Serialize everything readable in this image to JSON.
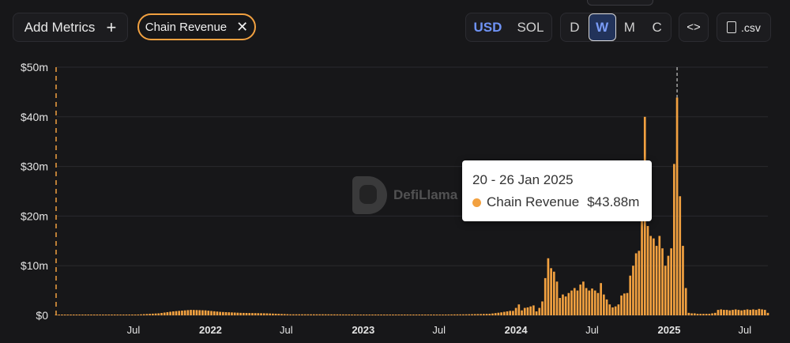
{
  "toolbar": {
    "add_metrics_label": "Add Metrics",
    "add_metrics_icon": "plus-icon",
    "chip_label": "Chain Revenue",
    "chip_close_icon": "close-icon",
    "currency_options": [
      "USD",
      "SOL"
    ],
    "currency_selected": "USD",
    "granularity_options": [
      "D",
      "W",
      "M",
      "C"
    ],
    "granularity_selected": "W",
    "embed_icon": "code-icon",
    "csv_label": ".csv",
    "csv_icon": "file-download-icon"
  },
  "watermark": {
    "text": "DefiLlama"
  },
  "tooltip": {
    "date": "20 - 26 Jan 2025",
    "series": "Chain Revenue",
    "value": "$43.88m"
  },
  "colors": {
    "background": "#171719",
    "series": "#f2a140",
    "accent": "#6f93f5",
    "grid": "#2a2a2e"
  },
  "chart_data": {
    "type": "bar",
    "title": "",
    "xlabel": "",
    "ylabel": "",
    "ylim": [
      0,
      50
    ],
    "y_unit": "$m",
    "yticks": [
      "$0",
      "$10m",
      "$20m",
      "$30m",
      "$40m",
      "$50m"
    ],
    "yticks_values": [
      0,
      10,
      20,
      30,
      40,
      50
    ],
    "xticks": [
      {
        "label": "Jul",
        "date": "2021-07-01",
        "bold": false
      },
      {
        "label": "2022",
        "date": "2022-01-01",
        "bold": true
      },
      {
        "label": "Jul",
        "date": "2022-07-01",
        "bold": false
      },
      {
        "label": "2023",
        "date": "2023-01-01",
        "bold": true
      },
      {
        "label": "Jul",
        "date": "2023-07-01",
        "bold": false
      },
      {
        "label": "2024",
        "date": "2024-01-01",
        "bold": true
      },
      {
        "label": "Jul",
        "date": "2024-07-01",
        "bold": false
      },
      {
        "label": "2025",
        "date": "2025-01-01",
        "bold": true
      },
      {
        "label": "Jul",
        "date": "2025-07-01",
        "bold": false
      }
    ],
    "x_start": "2020-12-28",
    "x_end": "2025-08-25",
    "highlight_date": "2025-01-20",
    "grid": true,
    "series": [
      {
        "name": "Chain Revenue",
        "anchors": [
          [
            "2020-12-28",
            0.05
          ],
          [
            "2021-06-28",
            0.1
          ],
          [
            "2021-08-30",
            0.4
          ],
          [
            "2021-10-04",
            0.8
          ],
          [
            "2021-11-15",
            1.1
          ],
          [
            "2021-12-20",
            1.0
          ],
          [
            "2022-01-24",
            0.7
          ],
          [
            "2022-03-14",
            0.5
          ],
          [
            "2022-05-16",
            0.4
          ],
          [
            "2022-07-11",
            0.2
          ],
          [
            "2022-09-26",
            0.2
          ],
          [
            "2023-01-02",
            0.15
          ],
          [
            "2023-04-03",
            0.15
          ],
          [
            "2023-07-03",
            0.15
          ],
          [
            "2023-09-04",
            0.2
          ],
          [
            "2023-10-30",
            0.3
          ],
          [
            "2023-11-27",
            0.6
          ],
          [
            "2023-12-18",
            0.9
          ]
        ],
        "points": [
          [
            "2024-01-01",
            1.5
          ],
          [
            "2024-01-08",
            2.2
          ],
          [
            "2024-01-15",
            1.0
          ],
          [
            "2024-01-22",
            1.5
          ],
          [
            "2024-01-29",
            1.6
          ],
          [
            "2024-02-05",
            1.8
          ],
          [
            "2024-02-12",
            2.0
          ],
          [
            "2024-02-19",
            0.8
          ],
          [
            "2024-02-26",
            1.5
          ],
          [
            "2024-03-04",
            2.8
          ],
          [
            "2024-03-11",
            7.5
          ],
          [
            "2024-03-18",
            11.5
          ],
          [
            "2024-03-25",
            9.5
          ],
          [
            "2024-04-01",
            8.8
          ],
          [
            "2024-04-08",
            6.8
          ],
          [
            "2024-04-15",
            3.5
          ],
          [
            "2024-04-22",
            4.2
          ],
          [
            "2024-04-29",
            3.8
          ],
          [
            "2024-05-06",
            4.5
          ],
          [
            "2024-05-13",
            5.0
          ],
          [
            "2024-05-20",
            5.5
          ],
          [
            "2024-05-27",
            5.0
          ],
          [
            "2024-06-03",
            6.2
          ],
          [
            "2024-06-10",
            6.8
          ],
          [
            "2024-06-17",
            5.5
          ],
          [
            "2024-06-24",
            5.0
          ],
          [
            "2024-07-01",
            5.4
          ],
          [
            "2024-07-08",
            5.0
          ],
          [
            "2024-07-15",
            4.5
          ],
          [
            "2024-07-22",
            6.5
          ],
          [
            "2024-07-29",
            4.2
          ],
          [
            "2024-08-05",
            3.2
          ],
          [
            "2024-08-12",
            2.2
          ],
          [
            "2024-08-19",
            1.6
          ],
          [
            "2024-08-26",
            1.8
          ],
          [
            "2024-09-02",
            2.2
          ],
          [
            "2024-09-09",
            4.0
          ],
          [
            "2024-09-16",
            4.4
          ],
          [
            "2024-09-23",
            4.5
          ],
          [
            "2024-09-30",
            8.0
          ],
          [
            "2024-10-07",
            10.0
          ],
          [
            "2024-10-14",
            12.5
          ],
          [
            "2024-10-21",
            13.0
          ],
          [
            "2024-10-28",
            21.5
          ],
          [
            "2024-11-04",
            40.0
          ],
          [
            "2024-11-11",
            18.0
          ],
          [
            "2024-11-18",
            16.0
          ],
          [
            "2024-11-25",
            15.5
          ],
          [
            "2024-12-02",
            14.0
          ],
          [
            "2024-12-09",
            16.0
          ],
          [
            "2024-12-16",
            13.5
          ],
          [
            "2024-12-23",
            10.0
          ],
          [
            "2024-12-30",
            12.0
          ],
          [
            "2025-01-06",
            13.5
          ],
          [
            "2025-01-13",
            30.5
          ],
          [
            "2025-01-20",
            43.88
          ],
          [
            "2025-01-27",
            24.0
          ],
          [
            "2025-02-03",
            14.0
          ],
          [
            "2025-02-10",
            5.5
          ],
          [
            "2025-02-17",
            0.5
          ],
          [
            "2025-02-24",
            0.4
          ],
          [
            "2025-03-03",
            0.4
          ],
          [
            "2025-03-10",
            0.3
          ],
          [
            "2025-03-17",
            0.3
          ],
          [
            "2025-03-24",
            0.3
          ],
          [
            "2025-03-31",
            0.3
          ],
          [
            "2025-04-07",
            0.3
          ],
          [
            "2025-04-14",
            0.4
          ],
          [
            "2025-04-21",
            0.5
          ],
          [
            "2025-04-28",
            1.1
          ],
          [
            "2025-05-05",
            1.2
          ],
          [
            "2025-05-12",
            1.1
          ],
          [
            "2025-05-19",
            1.1
          ],
          [
            "2025-05-26",
            1.0
          ],
          [
            "2025-06-02",
            1.1
          ],
          [
            "2025-06-09",
            1.2
          ],
          [
            "2025-06-16",
            1.1
          ],
          [
            "2025-06-23",
            1.0
          ],
          [
            "2025-06-30",
            1.1
          ],
          [
            "2025-07-07",
            1.2
          ],
          [
            "2025-07-14",
            1.1
          ],
          [
            "2025-07-21",
            1.2
          ],
          [
            "2025-07-28",
            1.1
          ],
          [
            "2025-08-04",
            1.3
          ],
          [
            "2025-08-11",
            1.2
          ],
          [
            "2025-08-18",
            1.1
          ],
          [
            "2025-08-25",
            0.5
          ]
        ]
      }
    ]
  }
}
